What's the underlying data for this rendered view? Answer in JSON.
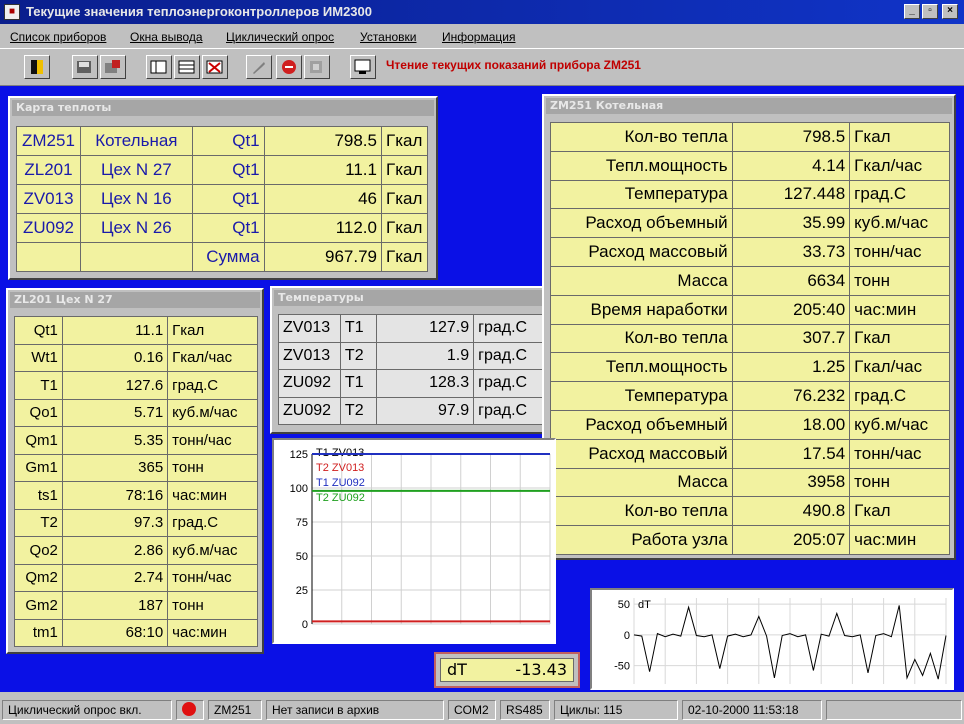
{
  "window": {
    "title": "Текущие значения теплоэнергоконтроллеров ИМ2300",
    "minimize": "_",
    "maximize": "▫",
    "close": "×"
  },
  "menu": [
    "Список приборов",
    "Окна вывода",
    "Циклический опрос",
    "Установки",
    "Информация"
  ],
  "toolbar": {
    "status_text": "Чтение текущих показаний прибора ZM251",
    "icons": [
      "door-icon",
      "save-icon",
      "export-icon",
      "window-icon",
      "table-icon",
      "delete-icon",
      "tool-icon",
      "stop-icon",
      "settings-icon",
      "screen-icon"
    ]
  },
  "panels": {
    "heat_map": {
      "title": "Карта теплоты",
      "rows": [
        [
          "ZM251",
          "Котельная",
          "Qt1",
          "798.5",
          "Гкал"
        ],
        [
          "ZL201",
          "Цех N 27",
          "Qt1",
          "11.1",
          "Гкал"
        ],
        [
          "ZV013",
          "Цех N 16",
          "Qt1",
          "46",
          "Гкал"
        ],
        [
          "ZU092",
          "Цех N 26",
          "Qt1",
          "112.0",
          "Гкал"
        ],
        [
          "",
          "",
          "Сумма",
          "967.79",
          "Гкал"
        ]
      ]
    },
    "zl201": {
      "title": "ZL201 Цех N 27",
      "rows": [
        [
          "Qt1",
          "11.1",
          "Гкал"
        ],
        [
          "Wt1",
          "0.16",
          "Гкал/час"
        ],
        [
          "T1",
          "127.6",
          "град.С"
        ],
        [
          "Qo1",
          "5.71",
          "куб.м/час"
        ],
        [
          "Qm1",
          "5.35",
          "тонн/час"
        ],
        [
          "Gm1",
          "365",
          "тонн"
        ],
        [
          "ts1",
          "78:16",
          "час:мин"
        ],
        [
          "T2",
          "97.3",
          "град.С"
        ],
        [
          "Qo2",
          "2.86",
          "куб.м/час"
        ],
        [
          "Qm2",
          "2.74",
          "тонн/час"
        ],
        [
          "Gm2",
          "187",
          "тонн"
        ],
        [
          "tm1",
          "68:10",
          "час:мин"
        ]
      ]
    },
    "temps": {
      "title": "Температуры",
      "rows": [
        [
          "ZV013",
          "T1",
          "127.9",
          "град.С"
        ],
        [
          "ZV013",
          "T2",
          "1.9",
          "град.С"
        ],
        [
          "ZU092",
          "T1",
          "128.3",
          "град.С"
        ],
        [
          "ZU092",
          "T2",
          "97.9",
          "град.С"
        ]
      ]
    },
    "zm251": {
      "title": "ZM251 Котельная",
      "rows": [
        [
          "Кол-во тепла",
          "798.5",
          "Гкал"
        ],
        [
          "Тепл.мощность",
          "4.14",
          "Гкал/час"
        ],
        [
          "Температура",
          "127.448",
          "град.С"
        ],
        [
          "Расход объемный",
          "35.99",
          "куб.м/час"
        ],
        [
          "Расход массовый",
          "33.73",
          "тонн/час"
        ],
        [
          "Масса",
          "6634",
          "тонн"
        ],
        [
          "Время наработки",
          "205:40",
          "час:мин"
        ],
        [
          "Кол-во тепла",
          "307.7",
          "Гкал"
        ],
        [
          "Тепл.мощность",
          "1.25",
          "Гкал/час"
        ],
        [
          "Температура",
          "76.232",
          "град.С"
        ],
        [
          "Расход объемный",
          "18.00",
          "куб.м/час"
        ],
        [
          "Расход массовый",
          "17.54",
          "тонн/час"
        ],
        [
          "Масса",
          "3958",
          "тонн"
        ],
        [
          "Кол-во тепла",
          "490.8",
          "Гкал"
        ],
        [
          "Работа узла",
          "205:07",
          "час:мин"
        ]
      ]
    },
    "dt_readout": {
      "label": "dT",
      "value": "-13.43"
    }
  },
  "chart_data": [
    {
      "type": "line",
      "ylim": [
        0,
        125
      ],
      "yticks": [
        "125",
        "100",
        "75",
        "50",
        "25",
        "0"
      ],
      "grid": true,
      "legend_position": "top-left",
      "series": [
        {
          "name": "T1 ZV013",
          "color": "#000000",
          "values": [
            125,
            125
          ]
        },
        {
          "name": "T2 ZV013",
          "color": "#d02020",
          "values": [
            1.9,
            1.9
          ]
        },
        {
          "name": "T1 ZU092",
          "color": "#2030c0",
          "values": [
            128,
            128
          ]
        },
        {
          "name": "T2 ZU092",
          "color": "#20a020",
          "values": [
            97.9,
            97.9
          ]
        }
      ]
    },
    {
      "type": "line",
      "ylabel": "dT",
      "ylim": [
        -80,
        60
      ],
      "yticks": [
        "50",
        "0",
        "-50"
      ],
      "grid": true,
      "series": [
        {
          "name": "dT",
          "color": "#000000",
          "values": [
            0,
            -2,
            -60,
            2,
            -3,
            1,
            -2,
            45,
            -1,
            -3,
            0,
            -55,
            -2,
            1,
            -3,
            0,
            30,
            -2,
            -70,
            -1,
            2,
            -3,
            0,
            -58,
            1,
            -2,
            35,
            -1,
            -3,
            0,
            -62,
            -1,
            2,
            -3,
            48,
            -70,
            -40,
            -66,
            -30,
            -72,
            -1
          ]
        }
      ]
    }
  ],
  "statusbar": {
    "mode": "Циклический опрос вкл.",
    "device": "ZM251",
    "archive": "Нет записи в архив",
    "port": "COM2",
    "interface": "RS485",
    "counter": "Циклы: 115",
    "datetime": "02-10-2000 11:53:18"
  }
}
